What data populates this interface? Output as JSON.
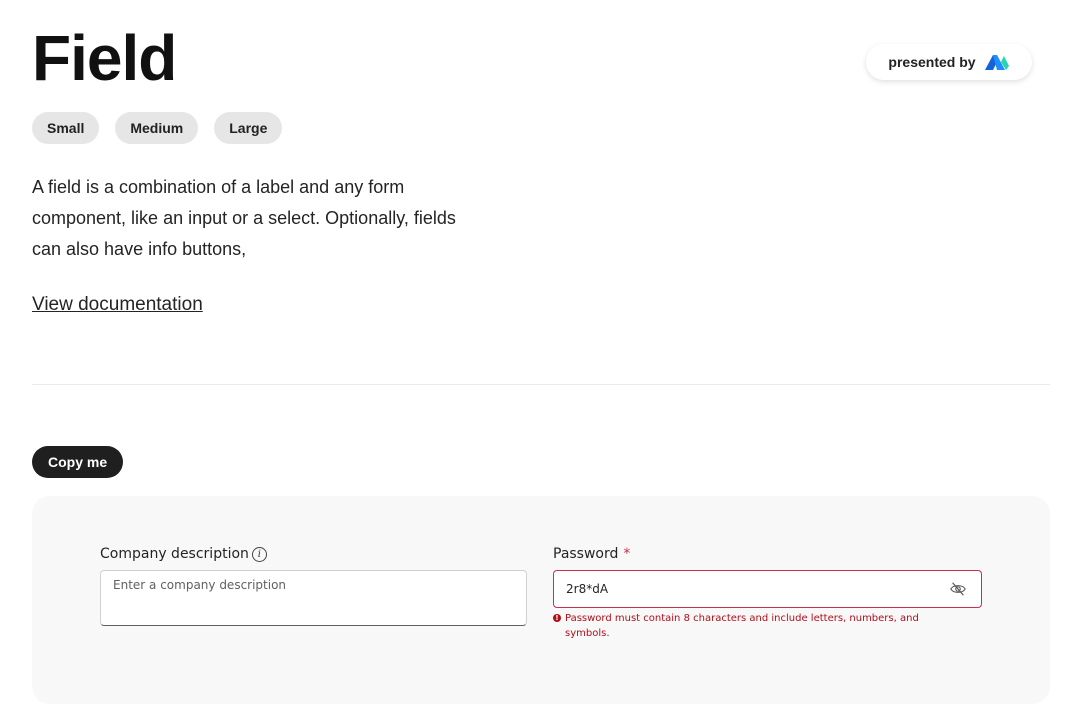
{
  "page": {
    "title": "Field",
    "presented_by_label": "presented by",
    "size_chips": [
      "Small",
      "Medium",
      "Large"
    ],
    "description": "A field is a combination of a label and any form component, like an input or a select. Optionally, fields can also have info buttons,",
    "doc_link": "View documentation",
    "copy_button": "Copy me"
  },
  "demo": {
    "company_field": {
      "label": "Company description",
      "placeholder": "Enter a company description",
      "value": ""
    },
    "password_field": {
      "label": "Password",
      "required_marker": "*",
      "value": "2r8*dA",
      "error": "Password must contain 8 characters and include letters, numbers, and symbols.",
      "error_icon": "!"
    }
  },
  "colors": {
    "error": "#c4314b",
    "chip_bg": "#e6e6e6",
    "copy_button_bg": "#1f1f1f",
    "panel_bg": "#f8f8f8"
  },
  "icons": [
    "brand-logo-icon",
    "info-icon",
    "eye-off-icon",
    "error-icon"
  ]
}
